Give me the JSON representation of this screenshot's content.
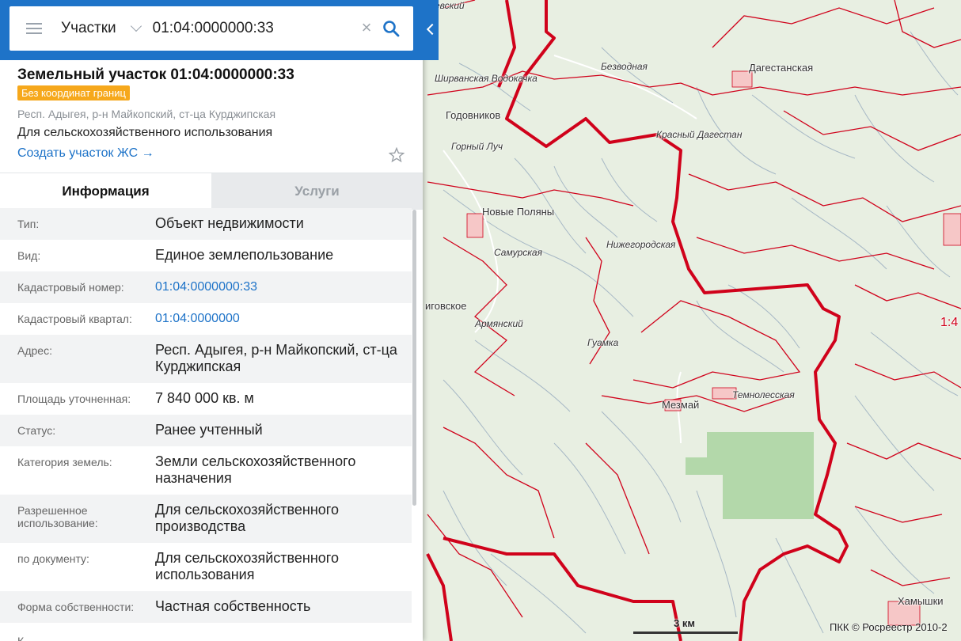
{
  "search": {
    "layer": "Участки",
    "query": "01:04:0000000:33"
  },
  "parcel": {
    "title": "Земельный участок 01:04:0000000:33",
    "badge": "Без координат границ",
    "address": "Респ. Адыгея, р-н Майкопский, ст-ца Курджипская",
    "usage": "Для сельскохозяйственного использования",
    "create_link": "Создать участок ЖС →"
  },
  "tabs": [
    {
      "label": "Информация",
      "active": true
    },
    {
      "label": "Услуги",
      "active": false
    }
  ],
  "info_rows": [
    {
      "label": "Тип:",
      "value": "Объект недвижимости"
    },
    {
      "label": "Вид:",
      "value": "Единое землепользование"
    },
    {
      "label": "Кадастровый номер:",
      "value": "01:04:0000000:33",
      "link": true
    },
    {
      "label": "Кадастровый квартал:",
      "value": "01:04:0000000",
      "link": true
    },
    {
      "label": "Адрес:",
      "value": "Респ. Адыгея, р-н Майкопский, ст-ца Курджипская"
    },
    {
      "label": "Площадь уточненная:",
      "value": "7 840 000 кв. м"
    },
    {
      "label": "Статус:",
      "value": "Ранее учтенный"
    },
    {
      "label": "Категория земель:",
      "value": "Земли сельскохозяйственного назначения"
    },
    {
      "label": "Разрешенное использование:",
      "value": "Для сельскохозяйственного производства"
    },
    {
      "label": "по документу:",
      "value": "Для сельскохозяйственного использования"
    },
    {
      "label": "Форма собственности:",
      "value": "Частная собственность"
    }
  ],
  "next_row_label_cut": "К",
  "map": {
    "places": [
      {
        "name": "евский"
      },
      {
        "name": "Безводная"
      },
      {
        "name": "Дагестанская"
      },
      {
        "name": "Ширванская Водокачка"
      },
      {
        "name": "Годовников"
      },
      {
        "name": "Красный Дагестан"
      },
      {
        "name": "Горный Луч"
      },
      {
        "name": "Новые Поляны"
      },
      {
        "name": "Нижегородская"
      },
      {
        "name": "Самурская"
      },
      {
        "name": "иговское"
      },
      {
        "name": "Армянский"
      },
      {
        "name": "Гуамка"
      },
      {
        "name": "Мезмай"
      },
      {
        "name": "Темнолесская"
      },
      {
        "name": "Хамышки"
      },
      {
        "name": "1:4"
      }
    ],
    "scale": "3 км",
    "copyright": "ПКК © Росреестр 2010-2",
    "colors": {
      "boundary": "#d0021b",
      "forest": "#dde8d5",
      "highlight": "#a9d6a0",
      "header": "#1e73c8"
    }
  }
}
